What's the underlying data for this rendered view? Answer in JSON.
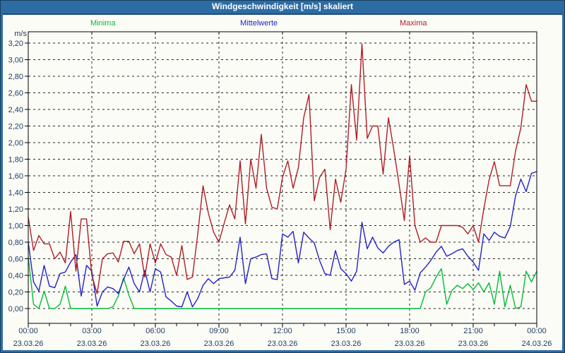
{
  "window": {
    "title": "Windgeschwindigkeit [m/s] skaliert"
  },
  "legend": {
    "items": [
      {
        "label": "Minima",
        "color": "#00bd33"
      },
      {
        "label": "Mittelwerte",
        "color": "#2222c8"
      },
      {
        "label": "Maxima",
        "color": "#b01e24"
      }
    ]
  },
  "y_axis": {
    "unit": "m/s",
    "tick_labels": [
      "0,00",
      "0,20",
      "0,40",
      "0,60",
      "0,80",
      "1,00",
      "1,20",
      "1,40",
      "1,60",
      "1,80",
      "2,00",
      "2,20",
      "2,40",
      "2,60",
      "2,80",
      "3,00",
      "3,20"
    ]
  },
  "x_axis": {
    "major_ticks": [
      {
        "time": "00:00",
        "date": "23.03.26"
      },
      {
        "time": "03:00",
        "date": "23.03.26"
      },
      {
        "time": "06:00",
        "date": "23.03.26"
      },
      {
        "time": "09:00",
        "date": "23.03.26"
      },
      {
        "time": "12:00",
        "date": "23.03.26"
      },
      {
        "time": "15:00",
        "date": "23.03.26"
      },
      {
        "time": "18:00",
        "date": "23.03.26"
      },
      {
        "time": "21:00",
        "date": "23.03.26"
      },
      {
        "time": "00:00",
        "date": "24.03.26"
      }
    ],
    "minor_tick_interval_minutes": 60
  },
  "chart_data": {
    "type": "line",
    "title": "Windgeschwindigkeit [m/s] skaliert",
    "ylabel": "m/s",
    "xlabel": "",
    "ylim": [
      0,
      3.2
    ],
    "y_step": 0.2,
    "x_start_minutes": 0,
    "x_interval_minutes": 15,
    "x_range_minutes": [
      0,
      1440
    ],
    "grid": "dashed, horizontal every 0.2 and vertical every 3h",
    "legend_position": "top",
    "series": [
      {
        "name": "Minima",
        "color": "#00bd33",
        "values": [
          0.62,
          0.05,
          0.0,
          0.21,
          0.0,
          0.0,
          0.05,
          0.27,
          0.0,
          0.0,
          0.0,
          0.0,
          0.0,
          0.0,
          0.0,
          0.0,
          0.02,
          0.15,
          0.37,
          0.16,
          0.0,
          0.0,
          0.0,
          0.0,
          0.0,
          0.0,
          0.0,
          0.0,
          0.0,
          0.0,
          0.0,
          0.0,
          0.0,
          0.0,
          0.0,
          0.0,
          0.0,
          0.0,
          0.0,
          0.0,
          0.0,
          0.0,
          0.0,
          0.0,
          0.0,
          0.0,
          0.0,
          0.0,
          0.0,
          0.0,
          0.0,
          0.0,
          0.0,
          0.0,
          0.0,
          0.0,
          0.0,
          0.0,
          0.0,
          0.0,
          0.0,
          0.0,
          0.0,
          0.0,
          0.0,
          0.0,
          0.0,
          0.0,
          0.0,
          0.0,
          0.0,
          0.0,
          0.0,
          0.0,
          0.0,
          0.2,
          0.25,
          0.38,
          0.48,
          0.05,
          0.22,
          0.28,
          0.24,
          0.3,
          0.23,
          0.31,
          0.2,
          0.31,
          0.05,
          0.45,
          0.02,
          0.28,
          0.0,
          0.02,
          0.45,
          0.32,
          0.45
        ]
      },
      {
        "name": "Mittelwerte",
        "color": "#2222c8",
        "values": [
          0.8,
          0.32,
          0.21,
          0.52,
          0.27,
          0.25,
          0.42,
          0.44,
          0.56,
          0.65,
          0.15,
          0.52,
          0.45,
          0.03,
          0.2,
          0.26,
          0.24,
          0.18,
          0.35,
          0.5,
          0.3,
          0.2,
          0.46,
          0.2,
          0.48,
          0.44,
          0.14,
          0.09,
          0.03,
          0.02,
          0.2,
          0.02,
          0.12,
          0.28,
          0.36,
          0.3,
          0.36,
          0.37,
          0.38,
          0.46,
          0.86,
          0.3,
          0.6,
          0.62,
          0.65,
          0.66,
          0.36,
          0.35,
          0.9,
          0.86,
          0.93,
          0.55,
          0.92,
          0.85,
          0.79,
          0.58,
          0.42,
          0.4,
          0.7,
          0.48,
          0.42,
          0.33,
          0.45,
          1.04,
          0.72,
          0.86,
          0.73,
          0.67,
          0.75,
          0.8,
          0.83,
          0.29,
          0.33,
          0.22,
          0.43,
          0.5,
          0.58,
          0.68,
          0.75,
          0.63,
          0.66,
          0.7,
          0.72,
          0.63,
          0.56,
          0.46,
          0.9,
          0.82,
          0.92,
          0.87,
          0.85,
          0.99,
          1.36,
          1.56,
          1.41,
          1.63,
          1.65
        ]
      },
      {
        "name": "Maxima",
        "color": "#b01e24",
        "values": [
          1.1,
          0.7,
          0.88,
          0.78,
          0.78,
          0.6,
          0.68,
          0.55,
          1.17,
          0.45,
          1.08,
          1.08,
          0.4,
          0.18,
          0.6,
          0.66,
          0.67,
          0.56,
          0.81,
          0.81,
          0.66,
          0.78,
          0.38,
          0.78,
          0.55,
          0.78,
          0.65,
          0.62,
          0.4,
          0.76,
          0.35,
          0.38,
          0.9,
          1.48,
          1.15,
          0.92,
          0.8,
          1.03,
          1.25,
          1.08,
          1.78,
          1.02,
          1.8,
          1.45,
          2.1,
          1.45,
          1.22,
          1.2,
          1.58,
          1.78,
          1.45,
          1.7,
          2.3,
          2.58,
          1.3,
          1.58,
          1.68,
          0.95,
          1.56,
          1.28,
          1.68,
          2.7,
          2.03,
          3.19,
          2.05,
          2.2,
          2.2,
          1.62,
          2.3,
          1.92,
          1.5,
          1.06,
          1.84,
          1.0,
          0.8,
          0.85,
          0.8,
          0.8,
          1.0,
          1.0,
          1.0,
          1.0,
          0.98,
          0.9,
          1.0,
          0.8,
          1.2,
          1.55,
          1.77,
          1.48,
          1.48,
          1.48,
          1.9,
          2.18,
          2.7,
          2.5,
          2.5
        ]
      }
    ]
  }
}
